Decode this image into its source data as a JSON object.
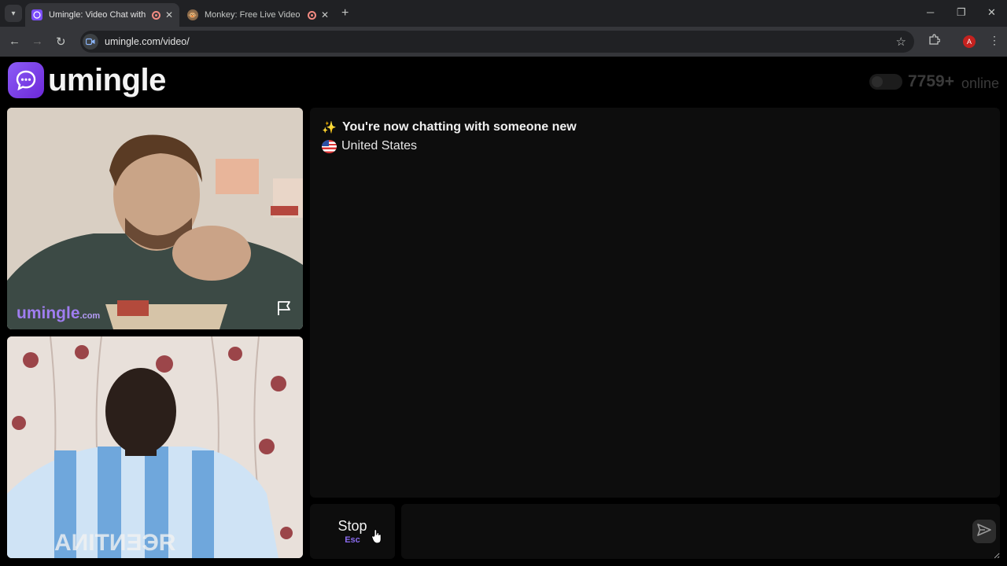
{
  "browser": {
    "tabs": [
      {
        "title": "Umingle: Video Chat with St",
        "active": true
      },
      {
        "title": "Monkey: Free Live Video Ch",
        "active": false
      }
    ],
    "new_tab": "+",
    "url": "umingle.com/video/",
    "profile_initial": "A",
    "window_controls": {
      "minimize": "─",
      "restore": "❐",
      "close": "✕"
    }
  },
  "header": {
    "logo_text": "umingle",
    "online_count": "7759+",
    "online_label": "online"
  },
  "videos": {
    "remote": {
      "watermark": "umingle",
      "watermark_suffix": ".com"
    }
  },
  "chat": {
    "status": "You're now chatting with someone new",
    "country": "United States"
  },
  "controls": {
    "stop_label": "Stop",
    "stop_key": "Esc"
  },
  "colors": {
    "brand": "#7c4dff",
    "accent_text": "#9f7df0"
  }
}
